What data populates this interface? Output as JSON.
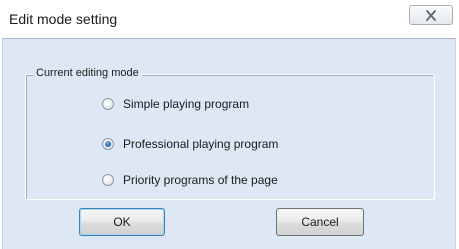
{
  "window": {
    "title": "Edit mode setting"
  },
  "mode_group": {
    "label": "Current editing mode",
    "options": [
      {
        "label": "Simple playing program",
        "checked": false
      },
      {
        "label": "Professional playing program",
        "checked": true
      },
      {
        "label": "Priority programs of the page",
        "checked": false
      }
    ]
  },
  "buttons": {
    "ok": "OK",
    "cancel": "Cancel"
  },
  "colors": {
    "client_background": "#dde8f4",
    "default_button_border": "#3c7fb1"
  }
}
